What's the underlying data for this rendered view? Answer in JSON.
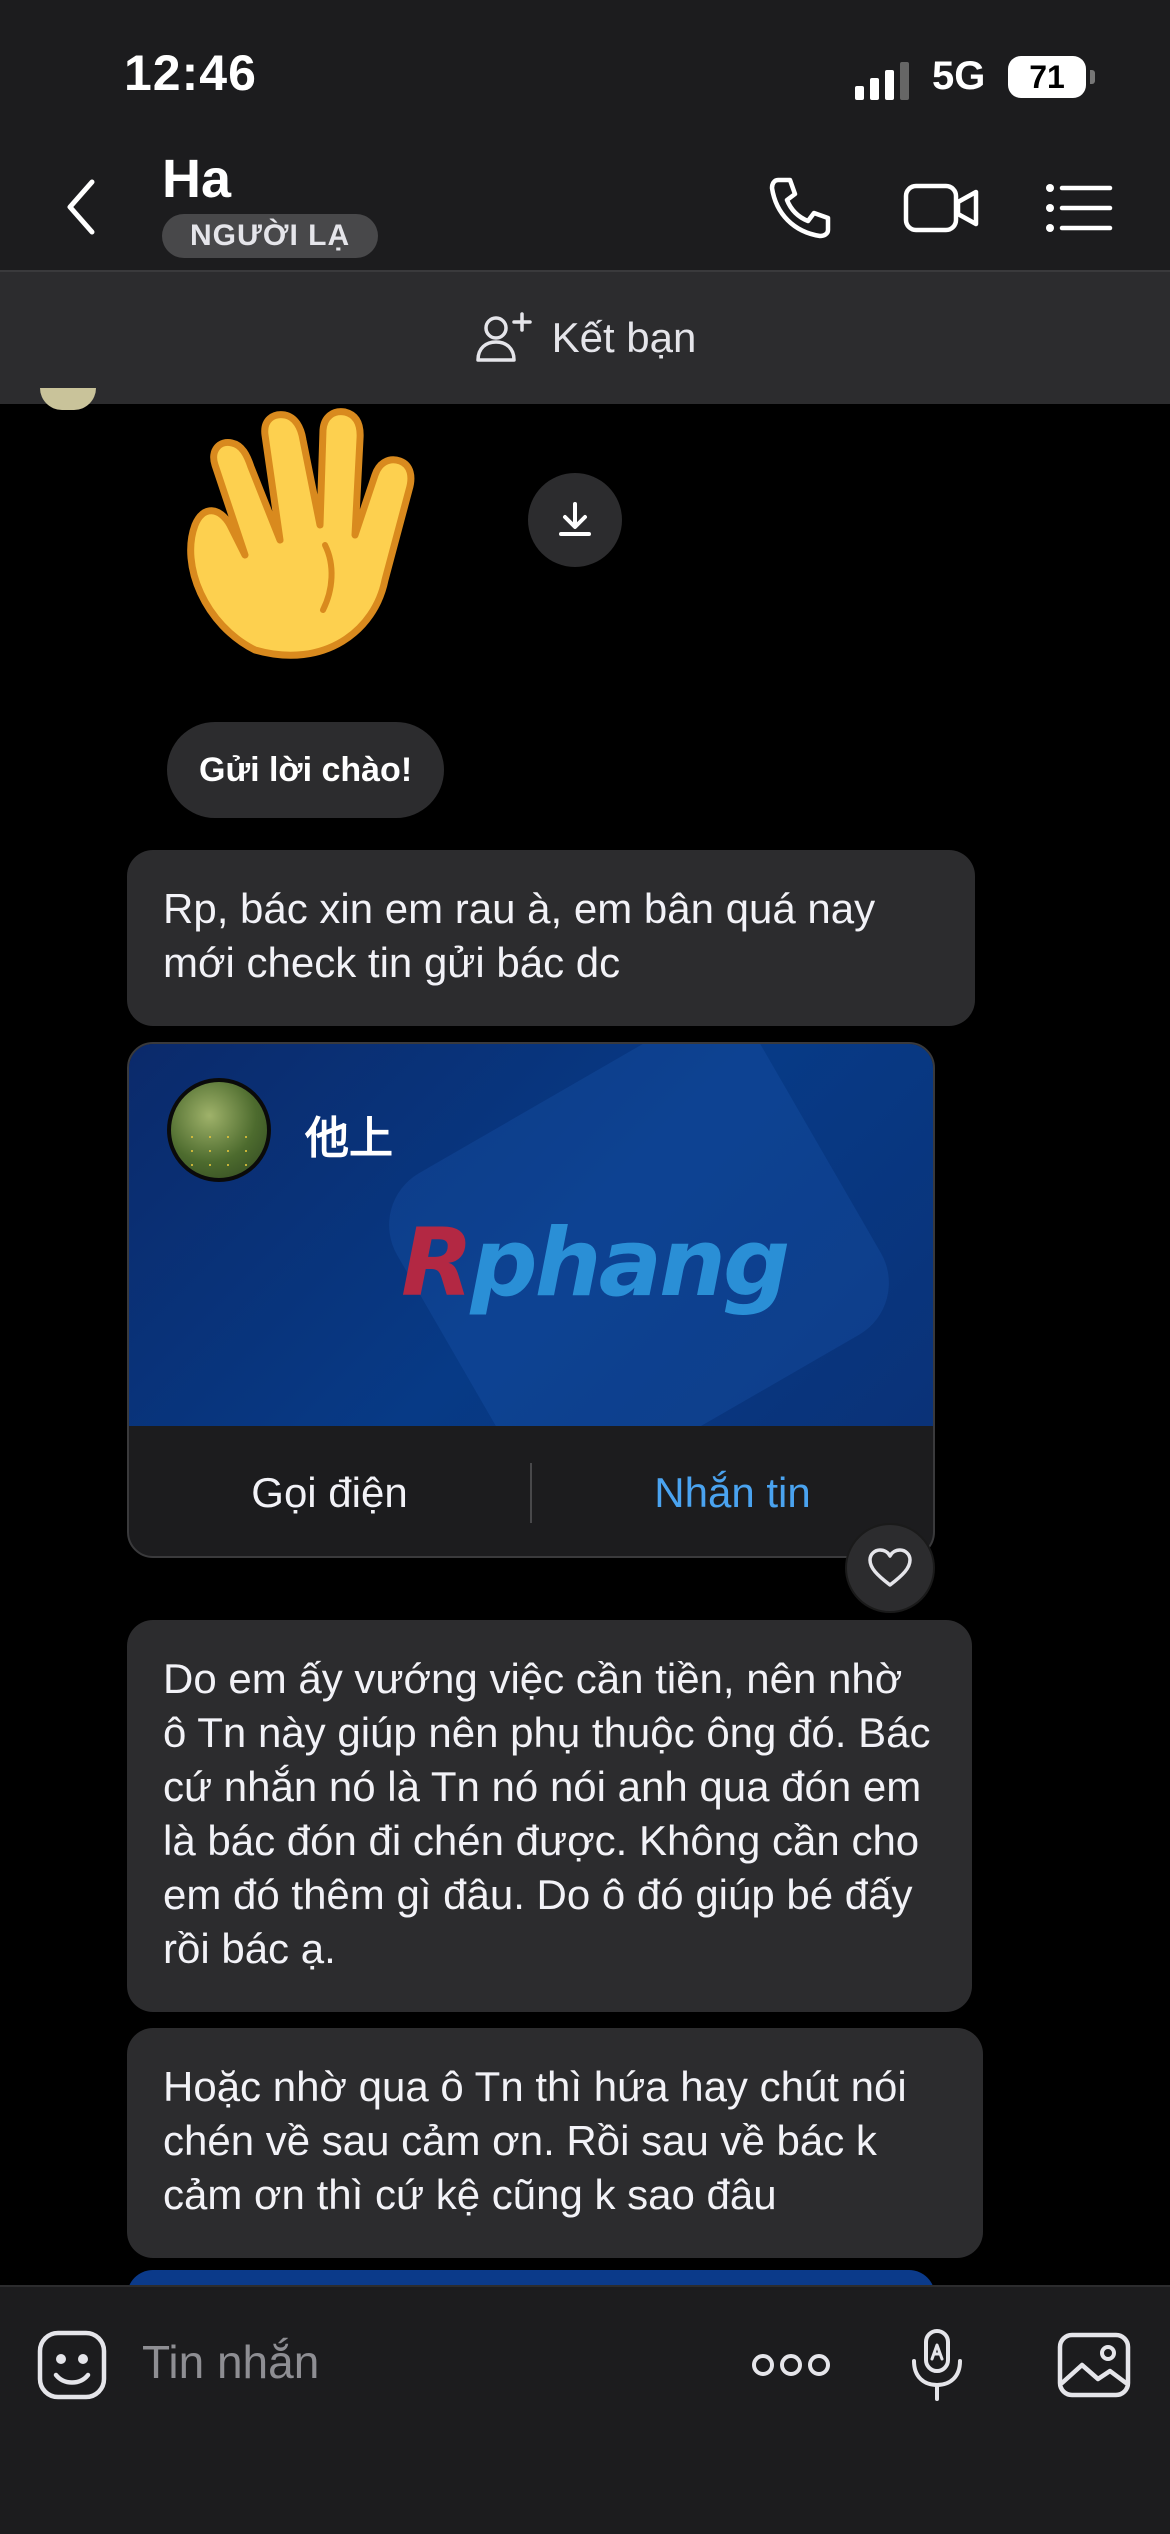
{
  "status_bar": {
    "time": "12:46",
    "network": "5G",
    "battery": "71"
  },
  "header": {
    "title": "Ha",
    "badge": "NGƯỜI LẠ"
  },
  "add_friend": {
    "label": "Kết bạn"
  },
  "messages": {
    "greeting_chip": "Gửi lời chào!",
    "msg1": "Rp, bác xin em rau à, em bân quá nay mới check tin gửi bác dc",
    "card": {
      "name": "他上",
      "logo_first": "R",
      "logo_rest": "phang",
      "call_label": "Gọi điện",
      "message_label": "Nhắn tin"
    },
    "msg2": "Do em ấy vướng việc cần tiền, nên nhờ ô Tn này giúp nên phụ thuộc ông đó. Bác cứ nhắn nó là Tn nó nói anh qua đón em là bác đón đi chén được. Không cần cho em đó thêm gì đâu. Do ô đó giúp bé đấy rồi bác ạ.",
    "msg3": "Hoặc nhờ qua ô Tn thì hứa hay chút nói chén về sau cảm ơn. Rồi sau về bác k cảm ơn thì cứ kệ cũng k sao đâu"
  },
  "input": {
    "placeholder": "Tin nhắn"
  },
  "colors": {
    "accent": "#4aa3f0",
    "bubble": "#2c2c2e",
    "background": "#000000",
    "bar": "#1c1c1e"
  }
}
